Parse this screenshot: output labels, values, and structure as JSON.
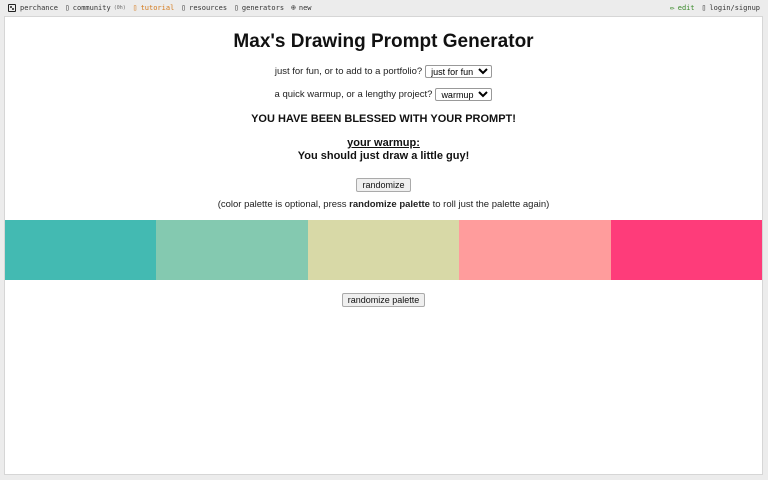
{
  "nav": {
    "brand": "perchance",
    "community": "community",
    "community_count": "(0h)",
    "tutorial": "tutorial",
    "resources": "resources",
    "generators": "generators",
    "new": "new",
    "edit": "edit",
    "login": "login/signup",
    "icons": {
      "brand": "dice-icon",
      "community": "chat-icon",
      "tutorial": "book-icon",
      "resources": "folder-icon",
      "generators": "list-icon",
      "new": "plus-circle-icon",
      "edit": "pencil-icon",
      "login": "user-icon"
    }
  },
  "page": {
    "title": "Max's Drawing Prompt Generator",
    "q1_label": "just for fun, or to add to a portfolio?",
    "q1_value": "just for fun",
    "q2_label": "a quick warmup, or a lengthy project?",
    "q2_value": "warmup",
    "blessed": "YOU HAVE BEEN BLESSED WITH YOUR PROMPT!",
    "result_label": "your warmup:",
    "result_text": "You should just draw a little guy!",
    "randomize_button": "randomize",
    "note_prefix": "(color palette is optional, press",
    "note_bold": "randomize palette",
    "note_suffix": "to roll just the palette again)",
    "palette_button": "randomize palette"
  },
  "palette": [
    "#43bab2",
    "#84c9b0",
    "#d8d9a7",
    "#ff9c9c",
    "#fe3c7a"
  ],
  "colors": {
    "tutorial": "#d47a1c",
    "edit": "#3a8a2a"
  }
}
